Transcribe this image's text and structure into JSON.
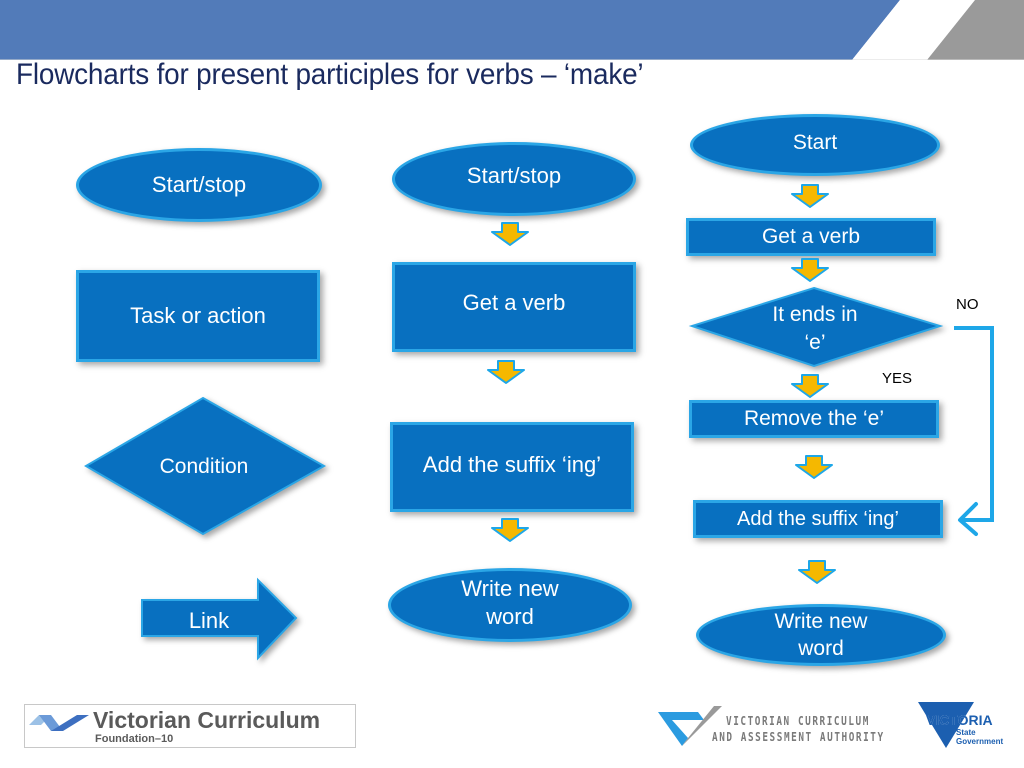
{
  "slide": {
    "title": "Flowcharts for present participles for verbs – ‘make’",
    "colors": {
      "banner_blue": "#527bb9",
      "banner_gray": "#9a9a9a",
      "title_navy": "#1a2a5e",
      "shape_fill": "#0870c0",
      "shape_border": "#2ba6e6",
      "arrow_fill": "#f5b800",
      "connector": "#1ea7e8"
    }
  },
  "legend": {
    "start_stop": "Start/stop",
    "task": "Task or action",
    "condition": "Condition",
    "link": "Link"
  },
  "general_flow": {
    "start": "Start/stop",
    "step1": "Get a verb",
    "step2": "Add the suffix ‘ing’",
    "end": "Write new word"
  },
  "make_flow": {
    "start": "Start",
    "step1": "Get a verb",
    "decision": "It ends in ‘e’",
    "no_label": "NO",
    "yes_label": "YES",
    "remove": "Remove the ‘e’",
    "add_suffix": "Add the suffix ‘ing’",
    "end": "Write new word"
  },
  "footer": {
    "vc_title": "Victorian Curriculum",
    "vc_subtitle": "Foundation–10",
    "vcaa_line1": "VICTORIAN CURRICULUM",
    "vcaa_line2": "AND ASSESSMENT AUTHORITY",
    "vic_name": "VICTORIA",
    "vic_sub1": "State",
    "vic_sub2": "Government"
  }
}
